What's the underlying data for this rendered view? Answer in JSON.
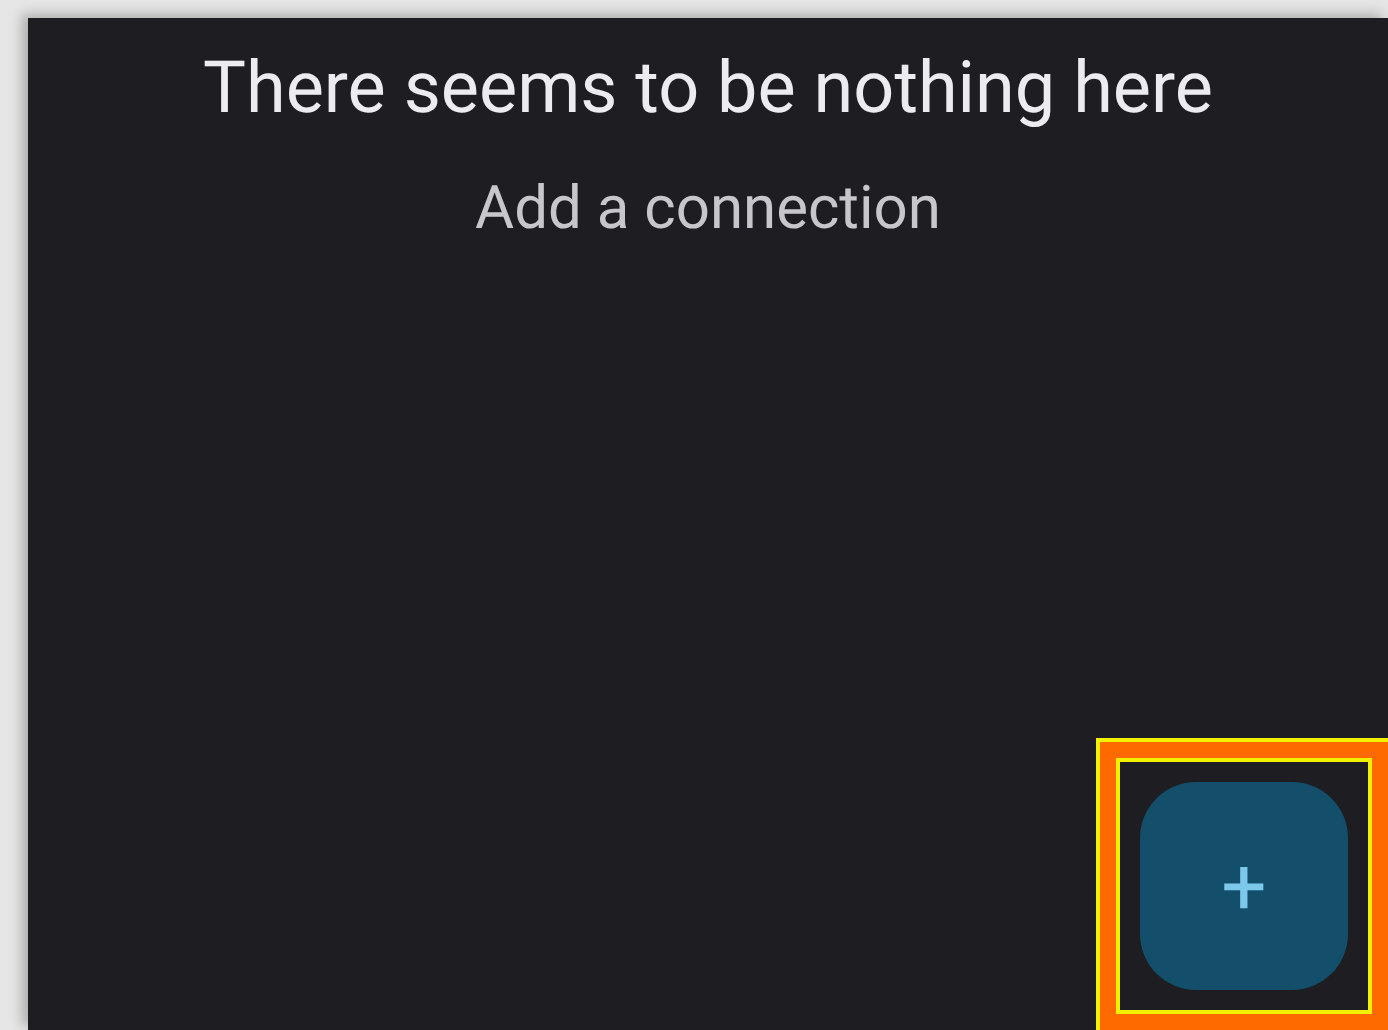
{
  "empty_state": {
    "title": "There seems to be nothing here",
    "subtitle": "Add a connection"
  },
  "fab": {
    "label": "+",
    "highlighted": true
  }
}
